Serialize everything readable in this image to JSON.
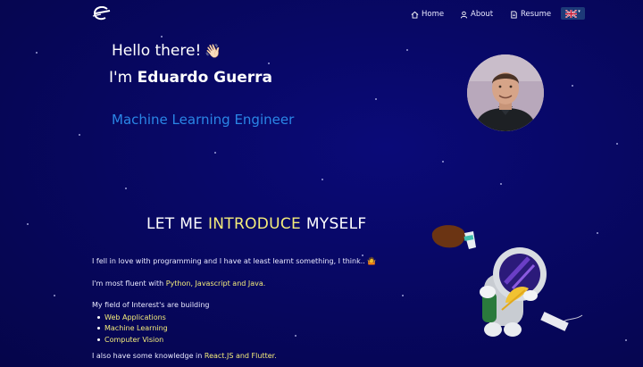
{
  "navbar": {
    "logo_icon": "stylized-e-logo-icon",
    "items": [
      {
        "label": "Home",
        "icon": "home-icon"
      },
      {
        "label": "About",
        "icon": "user-icon"
      },
      {
        "label": "Resume",
        "icon": "document-icon"
      }
    ],
    "language": {
      "icon": "uk-flag-icon",
      "caret": "▾"
    }
  },
  "hero": {
    "greeting": "Hello there!",
    "wave_emoji": "👋🏻",
    "intro_prefix": "I'm",
    "name": "Eduardo Guerra",
    "role": "Machine Learning Engineer",
    "avatar_icon": "profile-photo"
  },
  "about": {
    "title_prefix": "LET ME",
    "title_highlight": "INTRODUCE",
    "title_suffix": "MYSELF",
    "line1": "I fell in love with programming and I have at least learnt something, I think..",
    "line1_emoji": "🤷",
    "line2_prefix": "I'm most fluent with",
    "line2_highlight": "Python, Javascript and Java.",
    "line3": "My field of Interest's are building",
    "interests": [
      "Web Applications",
      "Machine Learning",
      "Computer Vision"
    ],
    "line4_prefix": "I also have some knowledge in",
    "line4_highlight": "React.JS and Flutter."
  },
  "colors": {
    "background": "#07075e",
    "highlight": "#f4ec7a",
    "role": "#2a86e6",
    "lang_button": "#1d3a78"
  }
}
